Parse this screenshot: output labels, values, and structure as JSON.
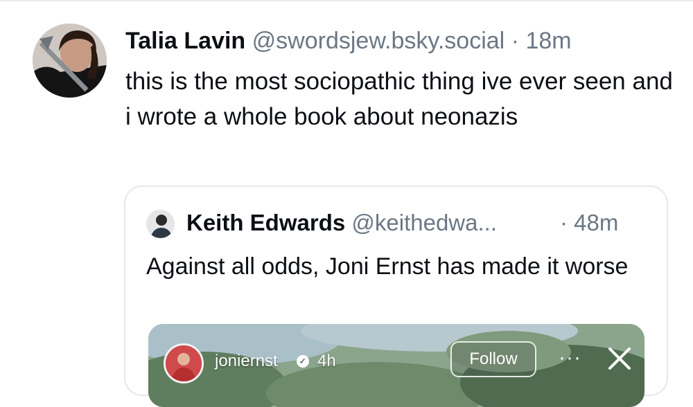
{
  "post": {
    "author_name": "Talia Lavin",
    "handle": "@swordsjew.bsky.social",
    "separator": "·",
    "time": "18m",
    "text": "this is the most sociopathic thing ive ever seen and i wrote a whole book about neonazis",
    "avatar_icon": "user-avatar-photo"
  },
  "quote": {
    "author_name": "Keith Edwards",
    "handle": "@keithedwa...",
    "separator": "·",
    "time": "48m",
    "text": "Against all odds, Joni Ernst has made it worse",
    "media": {
      "username": "joniernst",
      "verified_icon": "verified-check-icon",
      "time": "4h",
      "follow_label": "Follow",
      "more_label": "···",
      "close_icon": "close-icon"
    }
  },
  "colors": {
    "text_primary": "#0b0f14",
    "text_secondary": "#6b7785",
    "border": "#e3e8ed"
  }
}
